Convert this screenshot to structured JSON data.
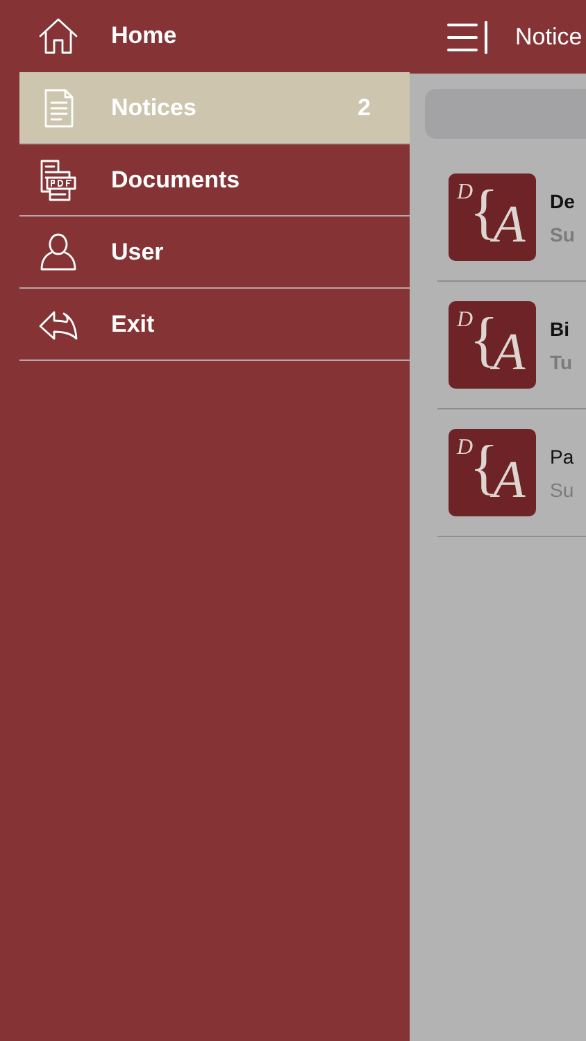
{
  "menu": [
    {
      "kind": "home",
      "label": "Home",
      "selected": false
    },
    {
      "kind": "notices",
      "label": "Notices",
      "badge": "2",
      "selected": true
    },
    {
      "kind": "documents",
      "label": "Documents",
      "selected": false
    },
    {
      "kind": "user",
      "label": "User",
      "selected": false
    },
    {
      "kind": "exit",
      "label": "Exit",
      "selected": false
    }
  ],
  "header": {
    "title": "Notice"
  },
  "notices": [
    {
      "logo": {
        "small": "D",
        "brace": "{",
        "big": "A"
      },
      "title": "De",
      "subtitle": "Su",
      "unread": true
    },
    {
      "logo": {
        "small": "D",
        "brace": "{",
        "big": "A"
      },
      "title": "Bi",
      "subtitle": "Tu",
      "unread": true
    },
    {
      "logo": {
        "small": "D",
        "brace": "{",
        "big": "A"
      },
      "title": "Pa",
      "subtitle": "Su",
      "unread": false
    }
  ]
}
